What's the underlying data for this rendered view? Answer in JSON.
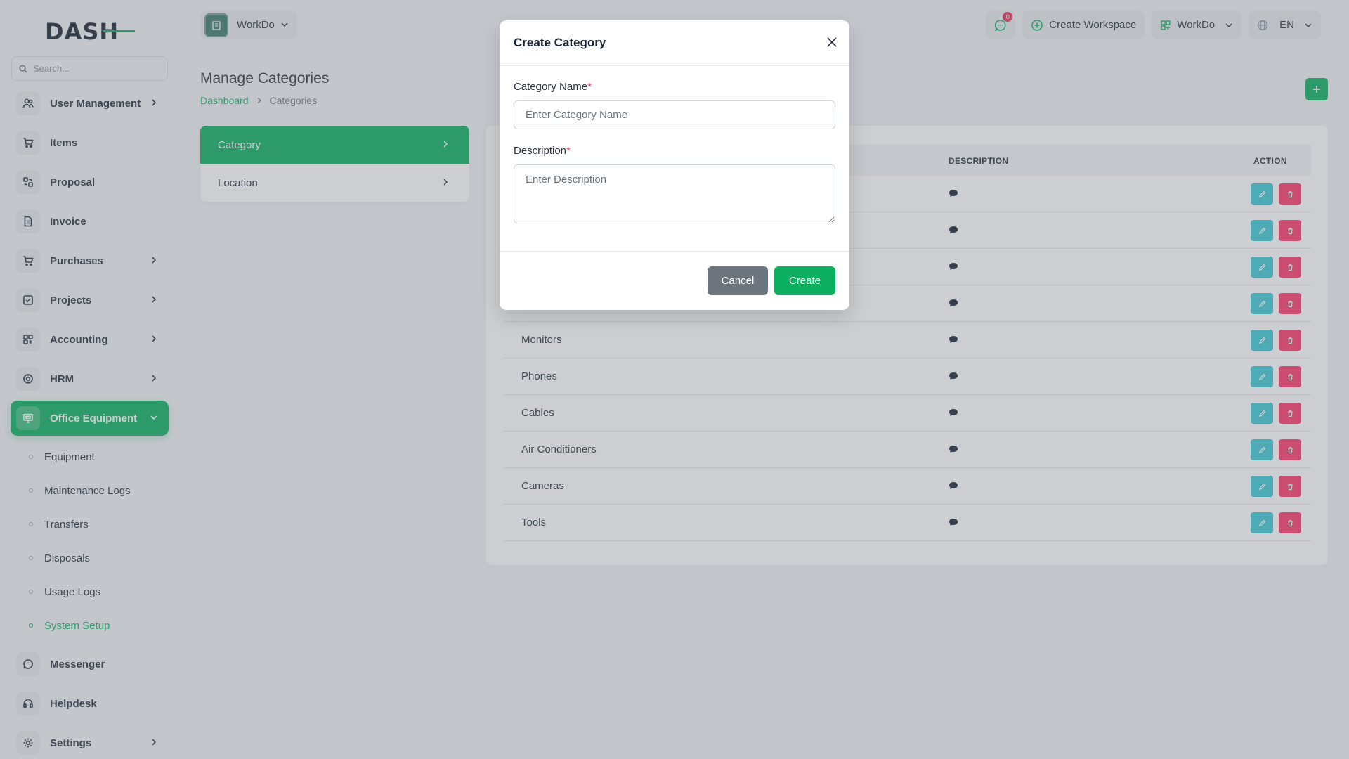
{
  "app": {
    "logo": "DASH"
  },
  "search": {
    "placeholder": "Search..."
  },
  "sidebar": {
    "items": [
      {
        "label": "User Management",
        "icon": "users-icon",
        "arrow": true
      },
      {
        "label": "Items",
        "icon": "cart-icon",
        "arrow": false
      },
      {
        "label": "Proposal",
        "icon": "proposal-icon",
        "arrow": false
      },
      {
        "label": "Invoice",
        "icon": "invoice-icon",
        "arrow": false
      },
      {
        "label": "Purchases",
        "icon": "cart-icon",
        "arrow": true
      },
      {
        "label": "Projects",
        "icon": "check-square-icon",
        "arrow": true
      },
      {
        "label": "Accounting",
        "icon": "grid-plus-icon",
        "arrow": true
      },
      {
        "label": "HRM",
        "icon": "hrm-icon",
        "arrow": true
      },
      {
        "label": "Office Equipment",
        "icon": "monitor-icon",
        "arrow": true,
        "active": true
      }
    ],
    "sub_items": [
      {
        "label": "Equipment"
      },
      {
        "label": "Maintenance Logs"
      },
      {
        "label": "Transfers"
      },
      {
        "label": "Disposals"
      },
      {
        "label": "Usage Logs"
      },
      {
        "label": "System Setup",
        "current": true
      }
    ],
    "bottom_items": [
      {
        "label": "Messenger",
        "icon": "chat-icon",
        "arrow": false
      },
      {
        "label": "Helpdesk",
        "icon": "headset-icon",
        "arrow": false
      },
      {
        "label": "Settings",
        "icon": "gear-icon",
        "arrow": true
      }
    ]
  },
  "header": {
    "workspace": "WorkDo",
    "notification_count": "0",
    "create_workspace": "Create Workspace",
    "workspace_switch": "WorkDo",
    "language": "EN"
  },
  "page": {
    "title": "Manage Categories",
    "breadcrumb": [
      "Dashboard",
      "Categories"
    ]
  },
  "tabs": [
    {
      "label": "Category",
      "active": true
    },
    {
      "label": "Location",
      "active": false
    }
  ],
  "table": {
    "columns": [
      "DESCRIPTION",
      "ACTION"
    ],
    "rows": [
      {
        "name": ""
      },
      {
        "name": ""
      },
      {
        "name": ""
      },
      {
        "name": ""
      },
      {
        "name": "Monitors"
      },
      {
        "name": "Phones"
      },
      {
        "name": "Cables"
      },
      {
        "name": "Air Conditioners"
      },
      {
        "name": "Cameras"
      },
      {
        "name": "Tools"
      }
    ]
  },
  "modal": {
    "title": "Create Category",
    "name_label": "Category Name",
    "name_placeholder": "Enter Category Name",
    "desc_label": "Description",
    "desc_placeholder": "Enter Description",
    "required_mark": "*",
    "cancel_label": "Cancel",
    "create_label": "Create"
  },
  "colors": {
    "primary": "#0caf60",
    "edit": "#3ec9d6",
    "delete": "#ff3a6e",
    "cancel": "#6c757d"
  }
}
